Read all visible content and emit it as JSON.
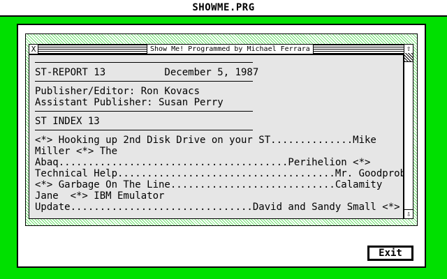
{
  "app": {
    "title": "SHOWME.PRG"
  },
  "window": {
    "title": "Show Me!  Programmed by Michael Ferrara",
    "close_icon": "X",
    "up_arrow": "⇧",
    "down_arrow": "⇩"
  },
  "document": {
    "lines": [
      {
        "type": "rule"
      },
      {
        "type": "text",
        "text": "ST-REPORT 13          December 5, 1987"
      },
      {
        "type": "rule"
      },
      {
        "type": "text",
        "text": "Publisher/Editor: Ron Kovacs"
      },
      {
        "type": "text",
        "text": "Assistant Publisher: Susan Perry"
      },
      {
        "type": "rule"
      },
      {
        "type": "text",
        "text": "ST INDEX 13"
      },
      {
        "type": "rule"
      },
      {
        "type": "text",
        "text": "<*> Hooking up 2nd Disk Drive on your ST..............Mike"
      },
      {
        "type": "text",
        "text": "Miller <*> The"
      },
      {
        "type": "text",
        "text": "Abaq.......................................Perihelion <*>"
      },
      {
        "type": "text",
        "text": "Technical Help.....................................Mr. Goodprobe"
      },
      {
        "type": "text",
        "text": "<*> Garbage On The Line............................Calamity"
      },
      {
        "type": "text",
        "text": "Jane  <*> IBM Emulator"
      },
      {
        "type": "text",
        "text": "Update...............................David and Sandy Small <*>"
      }
    ]
  },
  "buttons": {
    "exit_label": "Exit"
  }
}
